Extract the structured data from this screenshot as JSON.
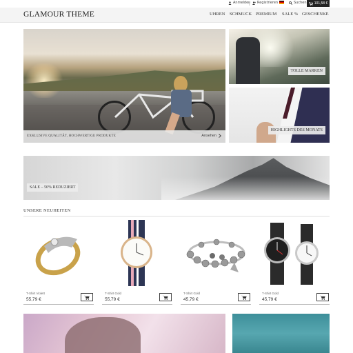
{
  "topbar": {
    "login": "Anmelden",
    "register": "Registrieren",
    "search": "Suchen",
    "cart_total": "101,58 €"
  },
  "header": {
    "logo": "GLAMOUR THEME",
    "nav": [
      "UHREN",
      "SCHMUCK",
      "PREMIUM",
      "SALE %",
      "GESCHENKE"
    ]
  },
  "hero": {
    "caption": "EXKLUSIVE QUALITÄT, HOCHWERTIGE PRODUKTE",
    "link": "Ansehen",
    "tiles": [
      "TOLLE MARKEN",
      "HIGHLIGHTS DES MONATS"
    ]
  },
  "banner": {
    "label": "SALE – 50% REDUZIERT"
  },
  "new_products": {
    "title": "UNSERE NEUHEITEN",
    "items": [
      {
        "name": "T-Shirt Violett",
        "price": "55,79 €"
      },
      {
        "name": "T-Shirt Gold",
        "price": "55,79 €"
      },
      {
        "name": "T-Shirt Gold",
        "price": "45,79 €"
      },
      {
        "name": "T-Shirt Gold",
        "price": "45,79 €"
      }
    ]
  }
}
